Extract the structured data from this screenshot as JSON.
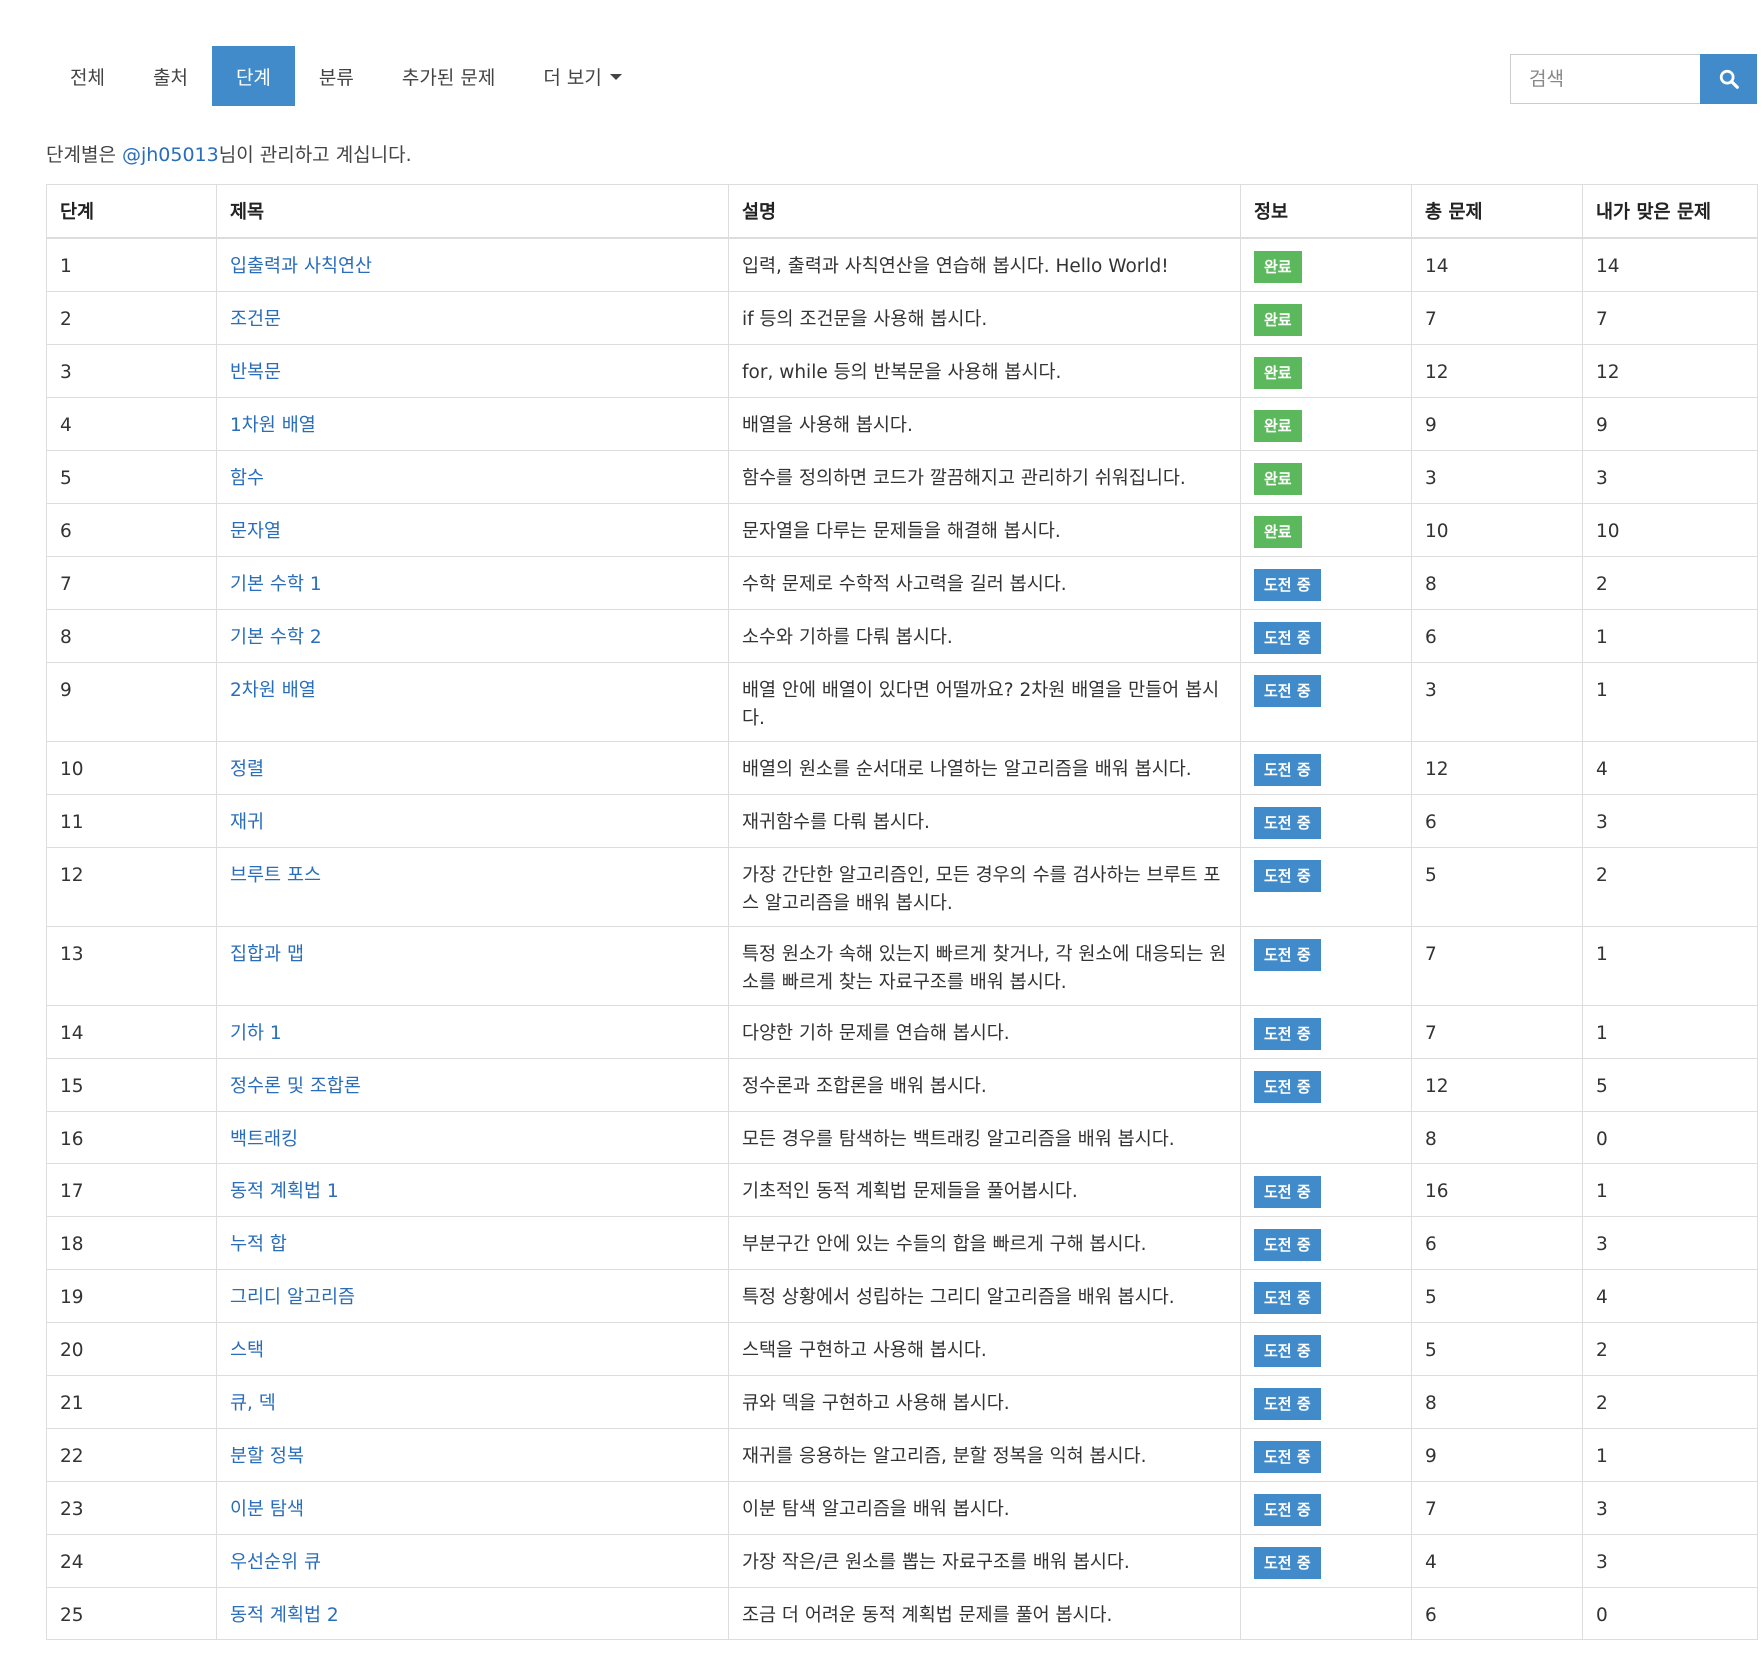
{
  "nav": {
    "tabs": [
      {
        "label": "전체"
      },
      {
        "label": "출처"
      },
      {
        "label": "단계"
      },
      {
        "label": "분류"
      },
      {
        "label": "추가된 문제"
      },
      {
        "label": "더 보기"
      }
    ],
    "active_tab": "단계"
  },
  "search": {
    "placeholder": "검색",
    "button_icon": "search-icon"
  },
  "notice": {
    "prefix": "단계별은 ",
    "user": "@jh05013",
    "suffix": "님이 관리하고 계십니다."
  },
  "colors": {
    "accent": "#428bca",
    "done": "#5cb85c",
    "link": "#2a6ebb"
  },
  "table": {
    "headers": [
      "단계",
      "제목",
      "설명",
      "정보",
      "총 문제",
      "내가 맞은 문제"
    ],
    "rows": [
      {
        "step": "1",
        "title": "입출력과 사칙연산",
        "desc": "입력, 출력과 사칙연산을 연습해 봅시다. Hello World!",
        "status": "완료",
        "status_type": "done",
        "total": "14",
        "solved": "14"
      },
      {
        "step": "2",
        "title": "조건문",
        "desc": "if 등의 조건문을 사용해 봅시다.",
        "status": "완료",
        "status_type": "done",
        "total": "7",
        "solved": "7"
      },
      {
        "step": "3",
        "title": "반복문",
        "desc": "for, while 등의 반복문을 사용해 봅시다.",
        "status": "완료",
        "status_type": "done",
        "total": "12",
        "solved": "12"
      },
      {
        "step": "4",
        "title": "1차원 배열",
        "desc": "배열을 사용해 봅시다.",
        "status": "완료",
        "status_type": "done",
        "total": "9",
        "solved": "9"
      },
      {
        "step": "5",
        "title": "함수",
        "desc": "함수를 정의하면 코드가 깔끔해지고 관리하기 쉬워집니다.",
        "status": "완료",
        "status_type": "done",
        "total": "3",
        "solved": "3"
      },
      {
        "step": "6",
        "title": "문자열",
        "desc": "문자열을 다루는 문제들을 해결해 봅시다.",
        "status": "완료",
        "status_type": "done",
        "total": "10",
        "solved": "10"
      },
      {
        "step": "7",
        "title": "기본 수학 1",
        "desc": "수학 문제로 수학적 사고력을 길러 봅시다.",
        "status": "도전 중",
        "status_type": "trying",
        "total": "8",
        "solved": "2"
      },
      {
        "step": "8",
        "title": "기본 수학 2",
        "desc": "소수와 기하를 다뤄 봅시다.",
        "status": "도전 중",
        "status_type": "trying",
        "total": "6",
        "solved": "1"
      },
      {
        "step": "9",
        "title": "2차원 배열",
        "desc": "배열 안에 배열이 있다면 어떨까요? 2차원 배열을 만들어 봅시다.",
        "status": "도전 중",
        "status_type": "trying",
        "total": "3",
        "solved": "1"
      },
      {
        "step": "10",
        "title": "정렬",
        "desc": "배열의 원소를 순서대로 나열하는 알고리즘을 배워 봅시다.",
        "status": "도전 중",
        "status_type": "trying",
        "total": "12",
        "solved": "4"
      },
      {
        "step": "11",
        "title": "재귀",
        "desc": "재귀함수를 다뤄 봅시다.",
        "status": "도전 중",
        "status_type": "trying",
        "total": "6",
        "solved": "3"
      },
      {
        "step": "12",
        "title": "브루트 포스",
        "desc": "가장 간단한 알고리즘인, 모든 경우의 수를 검사하는 브루트 포스 알고리즘을 배워 봅시다.",
        "status": "도전 중",
        "status_type": "trying",
        "total": "5",
        "solved": "2"
      },
      {
        "step": "13",
        "title": "집합과 맵",
        "desc": "특정 원소가 속해 있는지 빠르게 찾거나, 각 원소에 대응되는 원소를 빠르게 찾는 자료구조를 배워 봅시다.",
        "status": "도전 중",
        "status_type": "trying",
        "total": "7",
        "solved": "1"
      },
      {
        "step": "14",
        "title": "기하 1",
        "desc": "다양한 기하 문제를 연습해 봅시다.",
        "status": "도전 중",
        "status_type": "trying",
        "total": "7",
        "solved": "1"
      },
      {
        "step": "15",
        "title": "정수론 및 조합론",
        "desc": "정수론과 조합론을 배워 봅시다.",
        "status": "도전 중",
        "status_type": "trying",
        "total": "12",
        "solved": "5"
      },
      {
        "step": "16",
        "title": "백트래킹",
        "desc": "모든 경우를 탐색하는 백트래킹 알고리즘을 배워 봅시다.",
        "status": "",
        "status_type": "none",
        "total": "8",
        "solved": "0"
      },
      {
        "step": "17",
        "title": "동적 계획법 1",
        "desc": "기초적인 동적 계획법 문제들을 풀어봅시다.",
        "status": "도전 중",
        "status_type": "trying",
        "total": "16",
        "solved": "1"
      },
      {
        "step": "18",
        "title": "누적 합",
        "desc": "부분구간 안에 있는 수들의 합을 빠르게 구해 봅시다.",
        "status": "도전 중",
        "status_type": "trying",
        "total": "6",
        "solved": "3"
      },
      {
        "step": "19",
        "title": "그리디 알고리즘",
        "desc": "특정 상황에서 성립하는 그리디 알고리즘을 배워 봅시다.",
        "status": "도전 중",
        "status_type": "trying",
        "total": "5",
        "solved": "4"
      },
      {
        "step": "20",
        "title": "스택",
        "desc": "스택을 구현하고 사용해 봅시다.",
        "status": "도전 중",
        "status_type": "trying",
        "total": "5",
        "solved": "2"
      },
      {
        "step": "21",
        "title": "큐, 덱",
        "desc": "큐와 덱을 구현하고 사용해 봅시다.",
        "status": "도전 중",
        "status_type": "trying",
        "total": "8",
        "solved": "2"
      },
      {
        "step": "22",
        "title": "분할 정복",
        "desc": "재귀를 응용하는 알고리즘, 분할 정복을 익혀 봅시다.",
        "status": "도전 중",
        "status_type": "trying",
        "total": "9",
        "solved": "1"
      },
      {
        "step": "23",
        "title": "이분 탐색",
        "desc": "이분 탐색 알고리즘을 배워 봅시다.",
        "status": "도전 중",
        "status_type": "trying",
        "total": "7",
        "solved": "3"
      },
      {
        "step": "24",
        "title": "우선순위 큐",
        "desc": "가장 작은/큰 원소를 뽑는 자료구조를 배워 봅시다.",
        "status": "도전 중",
        "status_type": "trying",
        "total": "4",
        "solved": "3"
      },
      {
        "step": "25",
        "title": "동적 계획법 2",
        "desc": "조금 더 어려운 동적 계획법 문제를 풀어 봅시다.",
        "status": "",
        "status_type": "none",
        "total": "6",
        "solved": "0"
      }
    ]
  }
}
